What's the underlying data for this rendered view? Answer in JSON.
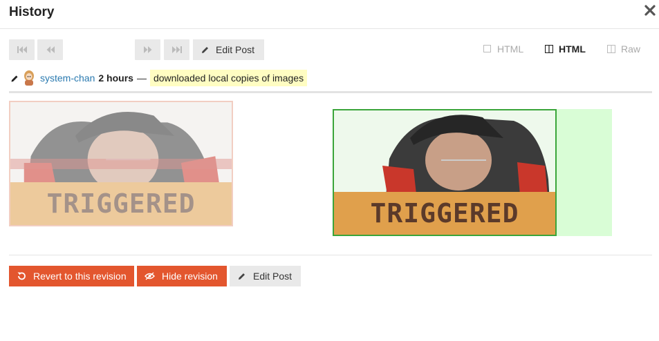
{
  "dialog": {
    "title": "History"
  },
  "toolbar": {
    "edit_post_label": "Edit Post",
    "view_modes": [
      {
        "label": "HTML",
        "active": false
      },
      {
        "label": "HTML",
        "active": true
      },
      {
        "label": "Raw",
        "active": false
      }
    ]
  },
  "revision": {
    "username": "system-chan",
    "time": "2 hours",
    "separator": "—",
    "message": "downloaded local copies of images"
  },
  "diff": {
    "old_image_text": "TRIGGERED",
    "new_image_text": "TRIGGERED"
  },
  "actions": {
    "revert_label": "Revert to this revision",
    "hide_label": "Hide revision",
    "edit_post_label": "Edit Post"
  },
  "colors": {
    "danger": "#e3562e",
    "link": "#2a7ab0",
    "added": "#d9fdd6",
    "added_border": "#3aa53a",
    "removed_border": "#e8a792",
    "message_highlight": "#fffdc2"
  }
}
